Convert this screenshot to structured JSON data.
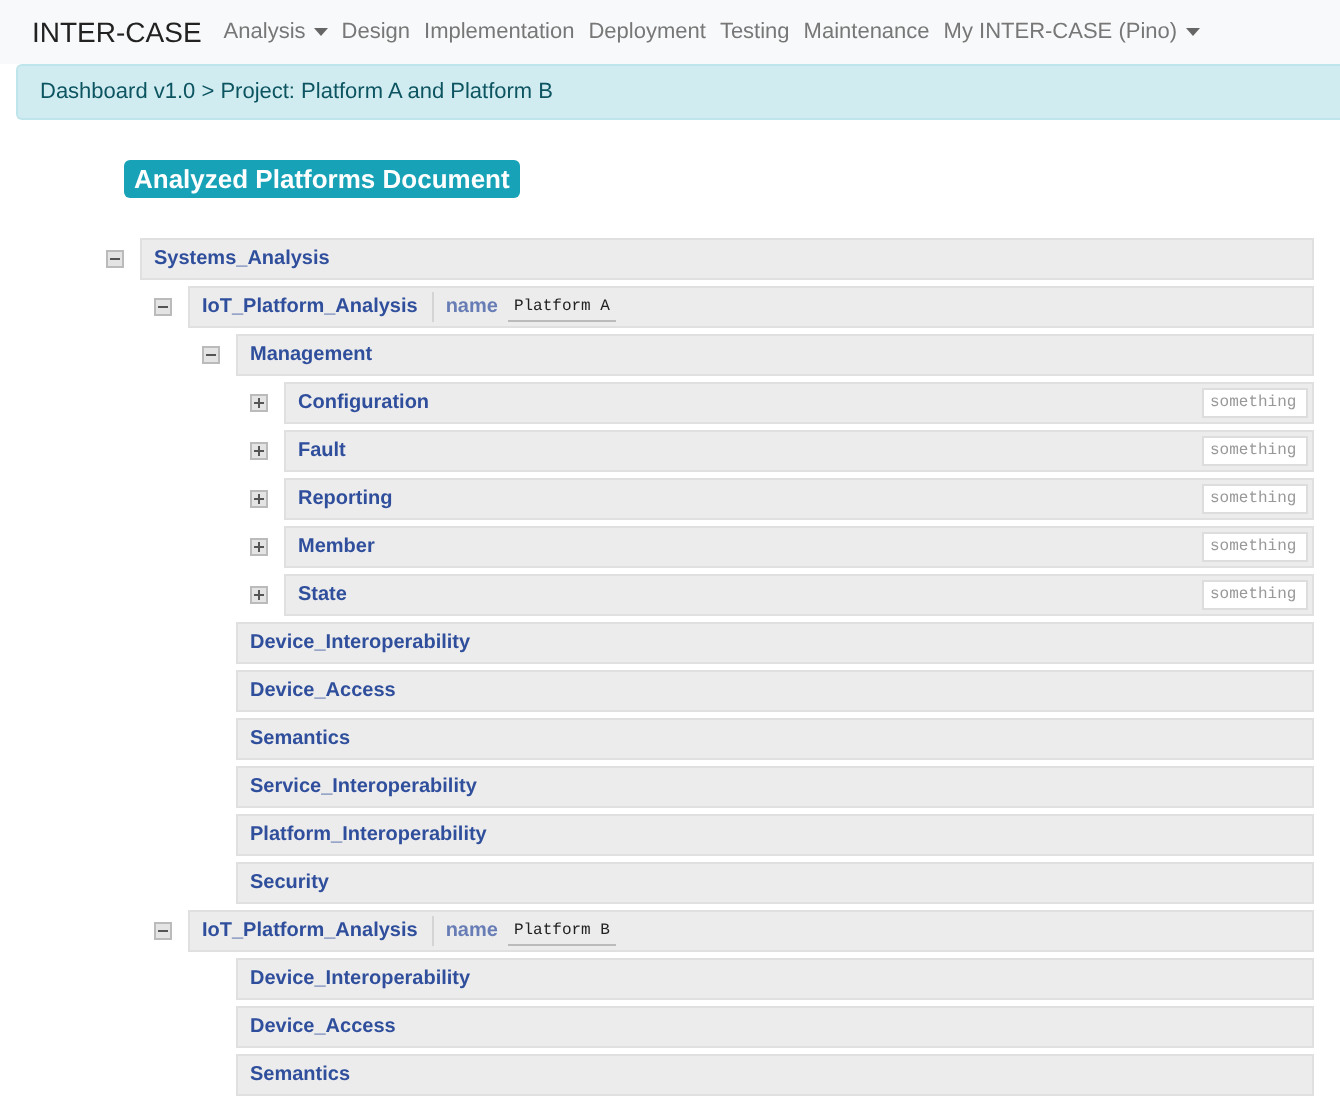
{
  "navbar": {
    "brand": "INTER-CASE",
    "items": [
      {
        "label": "Analysis",
        "dropdown": true
      },
      {
        "label": "Design",
        "dropdown": false
      },
      {
        "label": "Implementation",
        "dropdown": false
      },
      {
        "label": "Deployment",
        "dropdown": false
      },
      {
        "label": "Testing",
        "dropdown": false
      },
      {
        "label": "Maintenance",
        "dropdown": false
      },
      {
        "label": "My INTER-CASE (Pino)",
        "dropdown": true
      }
    ]
  },
  "breadcrumb": "Dashboard v1.0 > Project: Platform A and Platform B",
  "title": "Analyzed Platforms Document",
  "tree": [
    {
      "label": "Systems_Analysis",
      "expanded": true,
      "children": [
        {
          "label": "IoT_Platform_Analysis",
          "expanded": true,
          "attribute": {
            "name": "name",
            "value": "Platform A"
          },
          "children": [
            {
              "label": "Management",
              "expanded": true,
              "children": [
                {
                  "label": "Configuration",
                  "expanded": false,
                  "placeholder": "something"
                },
                {
                  "label": "Fault",
                  "expanded": false,
                  "placeholder": "something"
                },
                {
                  "label": "Reporting",
                  "expanded": false,
                  "placeholder": "something"
                },
                {
                  "label": "Member",
                  "expanded": false,
                  "placeholder": "something"
                },
                {
                  "label": "State",
                  "expanded": false,
                  "placeholder": "something"
                }
              ]
            },
            {
              "label": "Device_Interoperability"
            },
            {
              "label": "Device_Access"
            },
            {
              "label": "Semantics"
            },
            {
              "label": "Service_Interoperability"
            },
            {
              "label": "Platform_Interoperability"
            },
            {
              "label": "Security"
            }
          ]
        },
        {
          "label": "IoT_Platform_Analysis",
          "expanded": true,
          "attribute": {
            "name": "name",
            "value": "Platform B"
          },
          "children": [
            {
              "label": "Device_Interoperability"
            },
            {
              "label": "Device_Access"
            },
            {
              "label": "Semantics"
            }
          ]
        }
      ]
    }
  ]
}
